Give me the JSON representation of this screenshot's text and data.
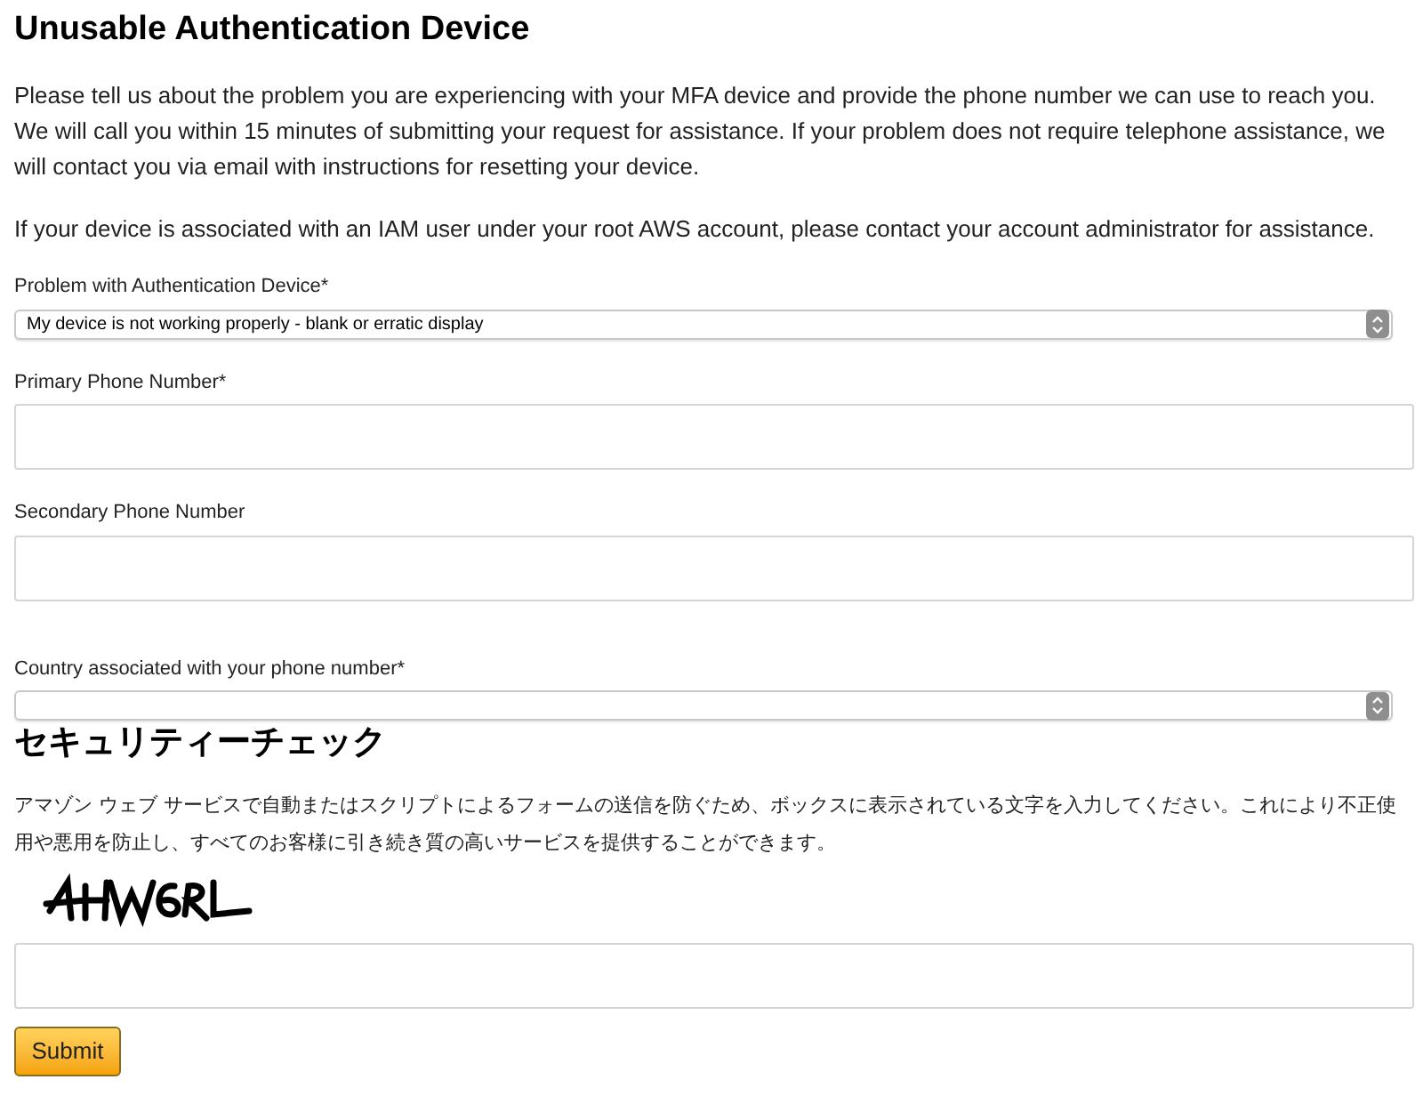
{
  "title": "Unusable Authentication Device",
  "paragraphs": [
    "Please tell us about the problem you are experiencing with your MFA device and provide the phone number we can use to reach you. We will call you within 15 minutes of submitting your request for assistance. If your problem does not require telephone assistance, we will contact you via email with instructions for resetting your device.",
    "If your device is associated with an IAM user under your root AWS account, please contact your account administrator for assistance."
  ],
  "fields": [
    {
      "kind": "select",
      "label": "Problem with Authentication Device*",
      "value": "My device is not working properly - blank or erratic display"
    },
    {
      "kind": "text",
      "label": "Primary Phone Number*"
    },
    {
      "kind": "text",
      "label": "Secondary Phone Number"
    },
    {
      "kind": "select",
      "label": "Country associated with your phone number*"
    }
  ],
  "security": {
    "heading": "セキュリティーチェック",
    "description": "アマゾン ウェブ サービスで自動またはスクリプトによるフォームの送信を防ぐため、ボックスに表示されている文字を入力してください。これにより不正使用や悪用を防止し、すべてのお客様に引き続き質の高いサービスを提供することができます。"
  },
  "submit": "Submit"
}
